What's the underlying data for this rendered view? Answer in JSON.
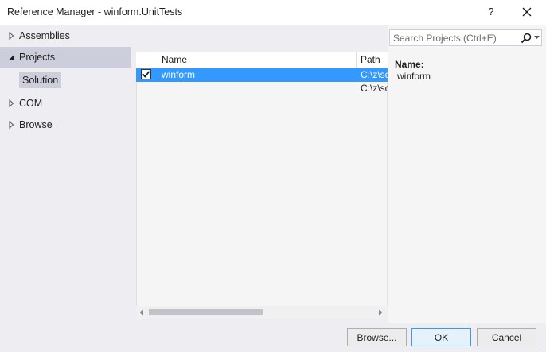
{
  "window": {
    "title": "Reference Manager - winform.UnitTests",
    "help_label": "?"
  },
  "nav": {
    "assemblies": "Assemblies",
    "projects": "Projects",
    "solution": "Solution",
    "com": "COM",
    "browse": "Browse"
  },
  "grid": {
    "columns": [
      "Name",
      "Path"
    ],
    "rows": [
      {
        "checked": true,
        "name": "winform",
        "path": "C:\\z\\sc"
      },
      {
        "checked": false,
        "name": "",
        "path": "C:\\z\\sc"
      }
    ]
  },
  "search": {
    "placeholder": "Search Projects (Ctrl+E)",
    "value": ""
  },
  "details": {
    "name_label": "Name:",
    "name_value": "winform"
  },
  "buttons": {
    "browse": "Browse...",
    "ok": "OK",
    "cancel": "Cancel"
  },
  "colors": {
    "selection": "#3399ff",
    "nav_selected": "#cccedb",
    "panel_bg": "#eeeef2"
  }
}
